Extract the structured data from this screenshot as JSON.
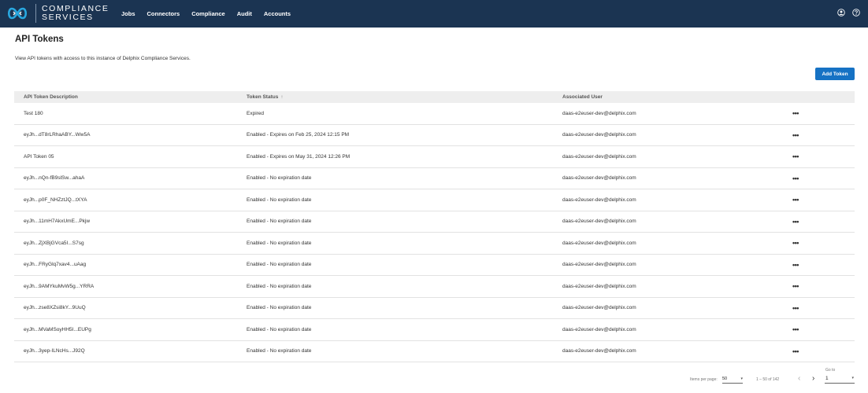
{
  "brand": {
    "line1": "COMPLIANCE",
    "line2": "SERVICES",
    "logo_icon": "infinity-logo-icon",
    "colors": {
      "header_bg": "#1b3452",
      "accent": "#1672c4"
    }
  },
  "nav": [
    "Jobs",
    "Connectors",
    "Compliance",
    "Audit",
    "Accounts"
  ],
  "top_icons": [
    "user-account-icon",
    "help-icon"
  ],
  "page": {
    "title": "API Tokens",
    "description": "View API tokens with access to this instance of Delphix Compliance Services.",
    "add_button": "Add Token"
  },
  "table": {
    "headers": [
      "API Token Description",
      "Token Status",
      "Associated User"
    ],
    "sort_indicator": "↑",
    "row_action": "•••",
    "rows": [
      {
        "description": "Test 180",
        "status": "Expired",
        "user": "daas-e2euser-dev@delphix.com"
      },
      {
        "description": "eyJh...dT8rLRhaABY...Ww5A",
        "status": "Enabled - Expires on Feb 25, 2024 12:15 PM",
        "user": "daas-e2euser-dev@delphix.com"
      },
      {
        "description": "API Token 05",
        "status": "Enabled - Expires on May 31, 2024 12:26 PM",
        "user": "daas-e2euser-dev@delphix.com"
      },
      {
        "description": "eyJh...nQn-fB9slSw...ahaA",
        "status": "Enabled - No expiration date",
        "user": "daas-e2euser-dev@delphix.com"
      },
      {
        "description": "eyJh...p0F_NHZztJQ...tXYA",
        "status": "Enabled - No expiration date",
        "user": "daas-e2euser-dev@delphix.com"
      },
      {
        "description": "eyJh...11mH7AkxUmE...Pkjw",
        "status": "Enabled - No expiration date",
        "user": "daas-e2euser-dev@delphix.com"
      },
      {
        "description": "eyJh...ZjXBjGVca5I...S7sg",
        "status": "Enabled - No expiration date",
        "user": "daas-e2euser-dev@delphix.com"
      },
      {
        "description": "eyJh...FRyGlq7xav4...uAag",
        "status": "Enabled - No expiration date",
        "user": "daas-e2euser-dev@delphix.com"
      },
      {
        "description": "eyJh...9AMYkuMvW5g...YRRA",
        "status": "Enabled - No expiration date",
        "user": "daas-e2euser-dev@delphix.com"
      },
      {
        "description": "eyJh...zse8XZsi8kY...9UuQ",
        "status": "Enabled - No expiration date",
        "user": "daas-e2euser-dev@delphix.com"
      },
      {
        "description": "eyJh...MVaMSoyHH5I...EUPg",
        "status": "Enabled - No expiration date",
        "user": "daas-e2euser-dev@delphix.com"
      },
      {
        "description": "eyJh...3yep-ILNcHs...J92Q",
        "status": "Enabled - No expiration date",
        "user": "daas-e2euser-dev@delphix.com"
      }
    ]
  },
  "pagination": {
    "items_per_page_label": "Items per page:",
    "items_per_page": "50",
    "range": "1 – 50 of 142",
    "prev": "‹",
    "next": "›",
    "goto_label": "Go to",
    "goto_value": "1",
    "dropdown_arrow": "▾"
  }
}
